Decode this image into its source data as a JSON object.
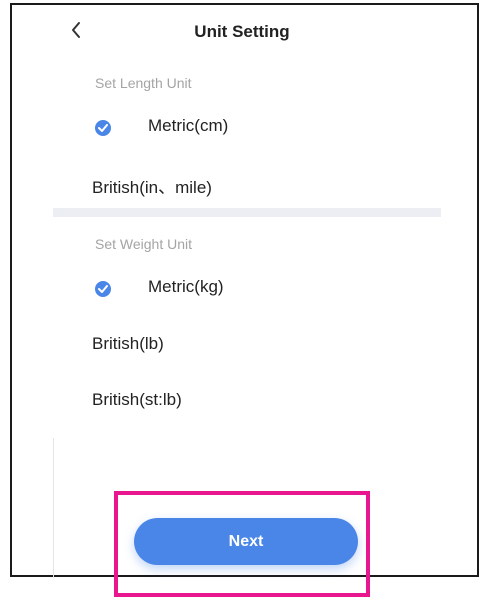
{
  "header": {
    "back_icon": "chevron-left-icon",
    "title": "Unit Setting"
  },
  "length_section": {
    "label": "Set Length Unit",
    "options": [
      {
        "label": "Metric(cm)",
        "selected": true
      },
      {
        "label": "British(in、mile)",
        "selected": false
      }
    ]
  },
  "weight_section": {
    "label": "Set Weight Unit",
    "options": [
      {
        "label": "Metric(kg)",
        "selected": true
      },
      {
        "label": "British(lb)",
        "selected": false
      },
      {
        "label": "British(st:lb)",
        "selected": false
      }
    ]
  },
  "footer": {
    "next_label": "Next"
  },
  "colors": {
    "accent": "#4a86e8",
    "highlight": "#e8168f",
    "divider": "#eceef3",
    "muted_text": "#a4a4a4"
  }
}
